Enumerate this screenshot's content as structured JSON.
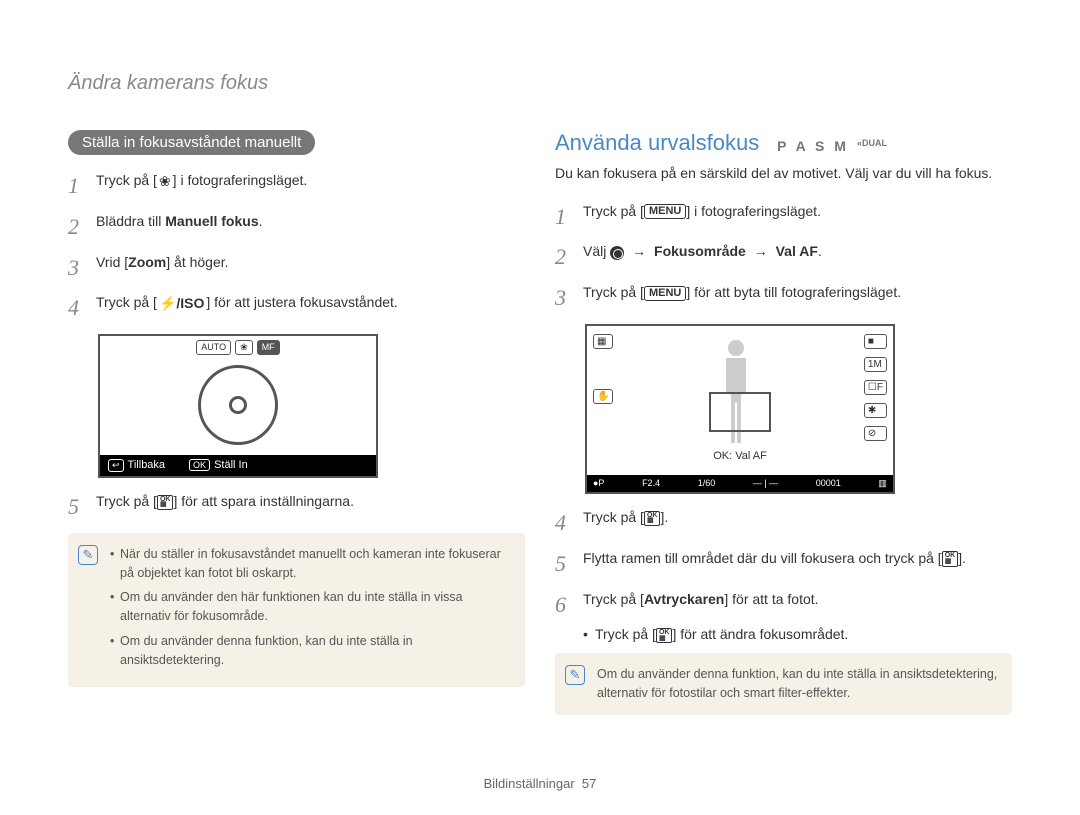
{
  "header": "Ändra kamerans fokus",
  "left": {
    "pill": "Ställa in fokusavståndet manuellt",
    "steps": {
      "s1_a": "Tryck på [",
      "s1_b": "] i fotograferingsläget.",
      "s2_a": "Bläddra till ",
      "s2_bold": "Manuell fokus",
      "s2_b": ".",
      "s3_a": "Vrid [",
      "s3_bold": "Zoom",
      "s3_b": "] åt höger.",
      "s4_a": "Tryck på [",
      "s4_b": "] för att justera fokusavståndet.",
      "s5_a": "Tryck på [",
      "s5_b": "] för att spara inställningarna."
    },
    "lcd": {
      "chip1": "AUTO",
      "chip2": "❀",
      "chip3": "MF",
      "back_tag": "↩",
      "back": "Tillbaka",
      "ok_tag": "OK",
      "ok": "Ställ In"
    },
    "note": [
      "När du ställer in fokusavståndet manuellt och kameran inte fokuserar på objektet kan fotot bli oskarpt.",
      "Om du använder den här funktionen kan du inte ställa in vissa alternativ för fokusområde.",
      "Om du använder denna funktion, kan du inte ställa in ansiktsdetektering."
    ]
  },
  "right": {
    "title": "Använda urvalsfokus",
    "modes": "P A S M",
    "mode_extra": "«DUAL",
    "intro": "Du kan fokusera på en särskild del av motivet. Välj var du vill ha fokus.",
    "steps": {
      "s1_a": "Tryck på [",
      "s1_key": "MENU",
      "s1_b": "] i fotograferingsläget.",
      "s2_a": "Välj ",
      "s2_bold1": "Fokusområde",
      "s2_bold2": "Val AF",
      "s2_end": ".",
      "s3_a": "Tryck på [",
      "s3_key": "MENU",
      "s3_b": "] för att byta till fotograferingsläget.",
      "s4_a": "Tryck på [",
      "s4_b": "].",
      "s5": "Flytta ramen till området där du vill fokusera och tryck på [",
      "s5_b": "].",
      "s6_a": "Tryck på [",
      "s6_bold": "Avtryckaren",
      "s6_b": "] för att ta fotot.",
      "sub": "Tryck på [",
      "sub_b": "] för att ändra fokusområdet."
    },
    "lcd": {
      "ok_label": "OK: Val AF",
      "strip_f": "F2.4",
      "strip_s": "1/60",
      "strip_n": "00001",
      "r_icons": [
        "■",
        "1M",
        "☐F",
        "✱",
        "⊘"
      ],
      "l_icon1": "▦",
      "l_icon2": "✋"
    },
    "note": "Om du använder denna funktion, kan du inte ställa in ansiktsdetektering, alternativ för fotostilar och smart filter-effekter.",
    "footer_a": "Bildinställningar",
    "footer_b": "57"
  },
  "icons": {
    "flower": "❀",
    "flash_iso": "⚡/ISO",
    "ok_top": "OK",
    "ok_bot": "▦",
    "arrow": "→"
  }
}
